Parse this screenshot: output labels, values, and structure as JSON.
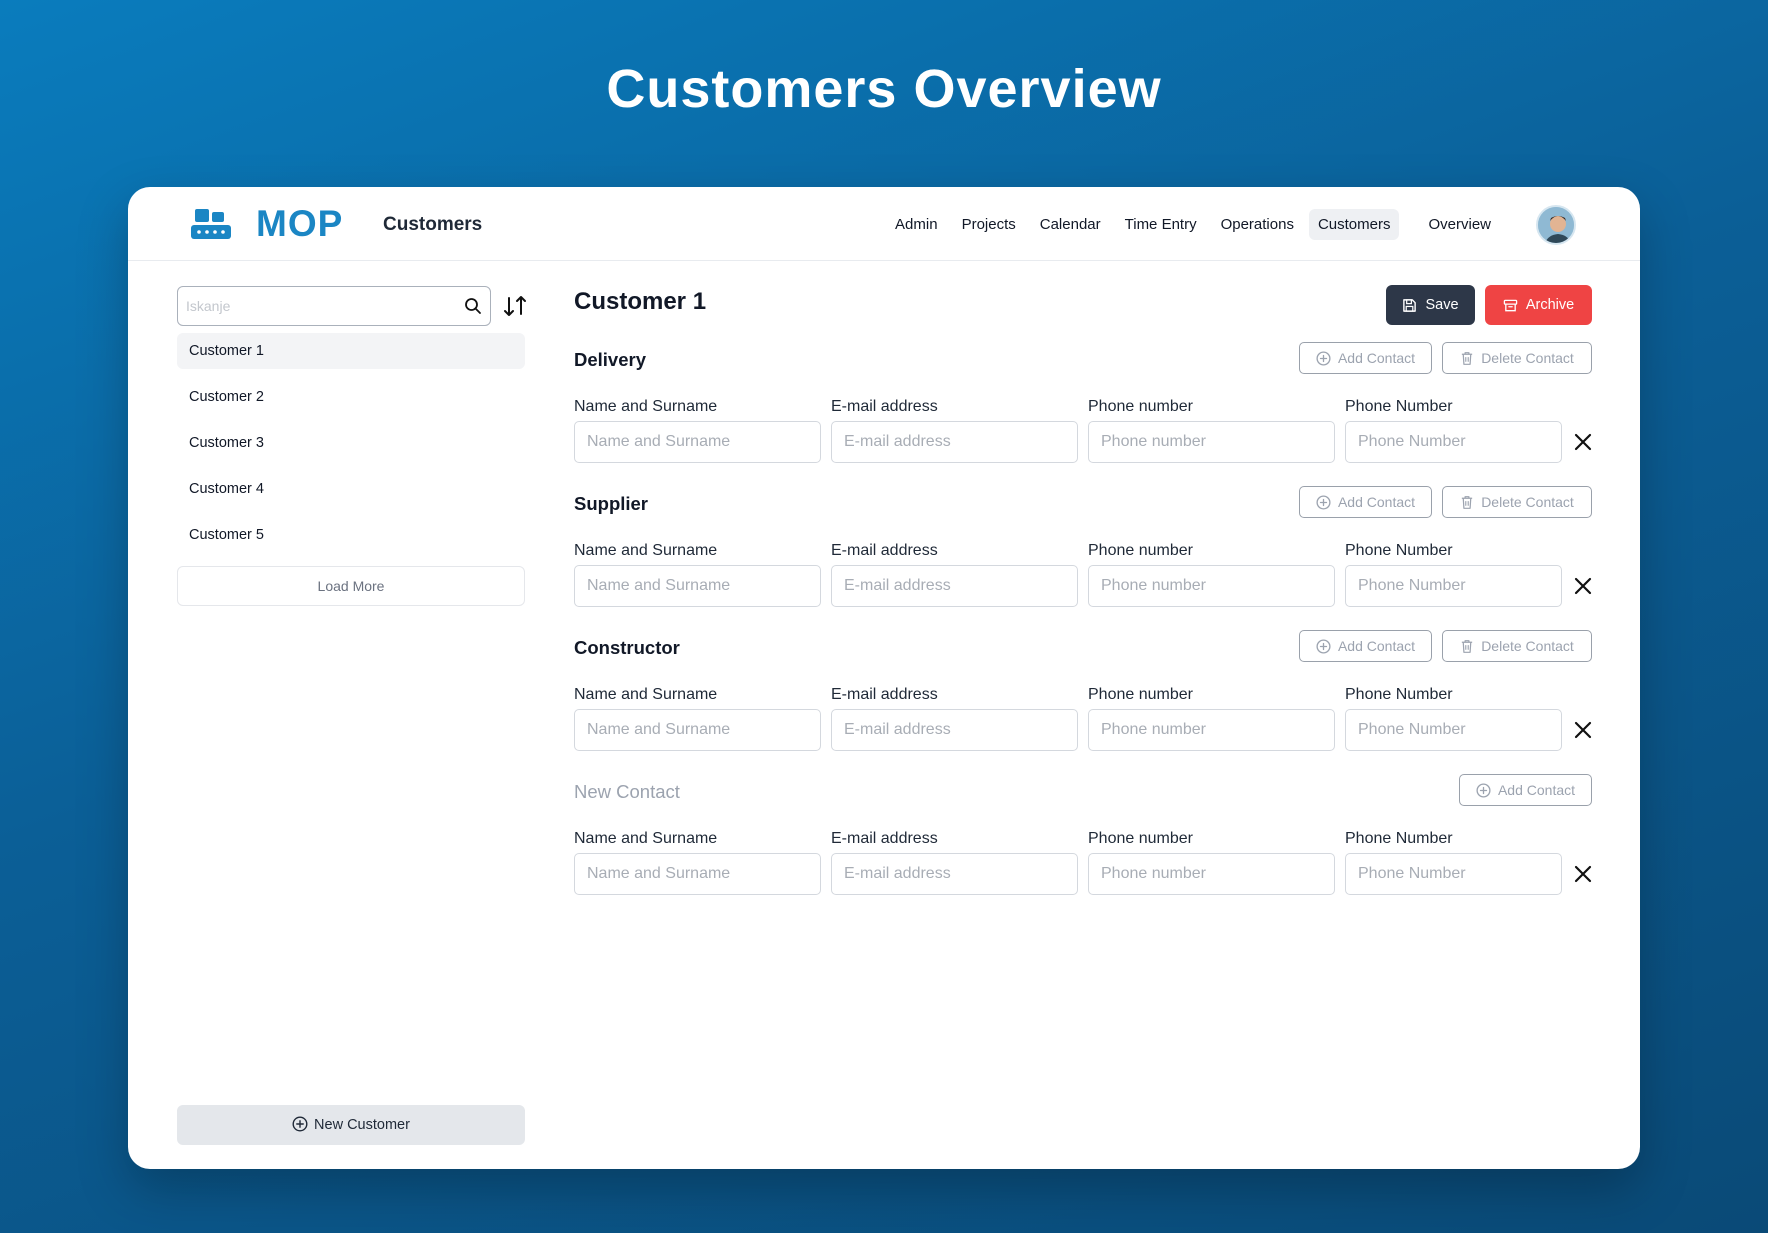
{
  "page": {
    "title": "Customers Overview"
  },
  "header": {
    "logo": "MOP",
    "section_title": "Customers",
    "nav": [
      "Admin",
      "Projects",
      "Calendar",
      "Time Entry",
      "Operations",
      "Customers",
      "Overview"
    ],
    "active_nav": "Customers"
  },
  "sidebar": {
    "search_placeholder": "Iskanje",
    "customers": [
      "Customer 1",
      "Customer 2",
      "Customer 3",
      "Customer 4",
      "Customer 5"
    ],
    "selected": "Customer 1",
    "load_more": "Load More",
    "new_customer": "New Customer"
  },
  "main": {
    "title": "Customer 1",
    "save_label": "Save",
    "archive_label": "Archive",
    "add_contact_label": "Add Contact",
    "delete_contact_label": "Delete Contact",
    "fields": {
      "name_label": "Name and Surname",
      "name_placeholder": "Name and Surname",
      "email_label": "E-mail address",
      "email_placeholder": "E-mail address",
      "phone_label": "Phone number",
      "phone_placeholder": "Phone number",
      "phone2_label": "Phone Number",
      "phone2_placeholder": "Phone Number"
    },
    "sections": [
      {
        "title": "Delivery"
      },
      {
        "title": "Supplier"
      },
      {
        "title": "Constructor"
      },
      {
        "title": "New Contact"
      }
    ]
  },
  "colors": {
    "brand": "#1b86c4",
    "save": "#2d3748",
    "archive": "#ef4444",
    "background": "#0b5f97"
  }
}
